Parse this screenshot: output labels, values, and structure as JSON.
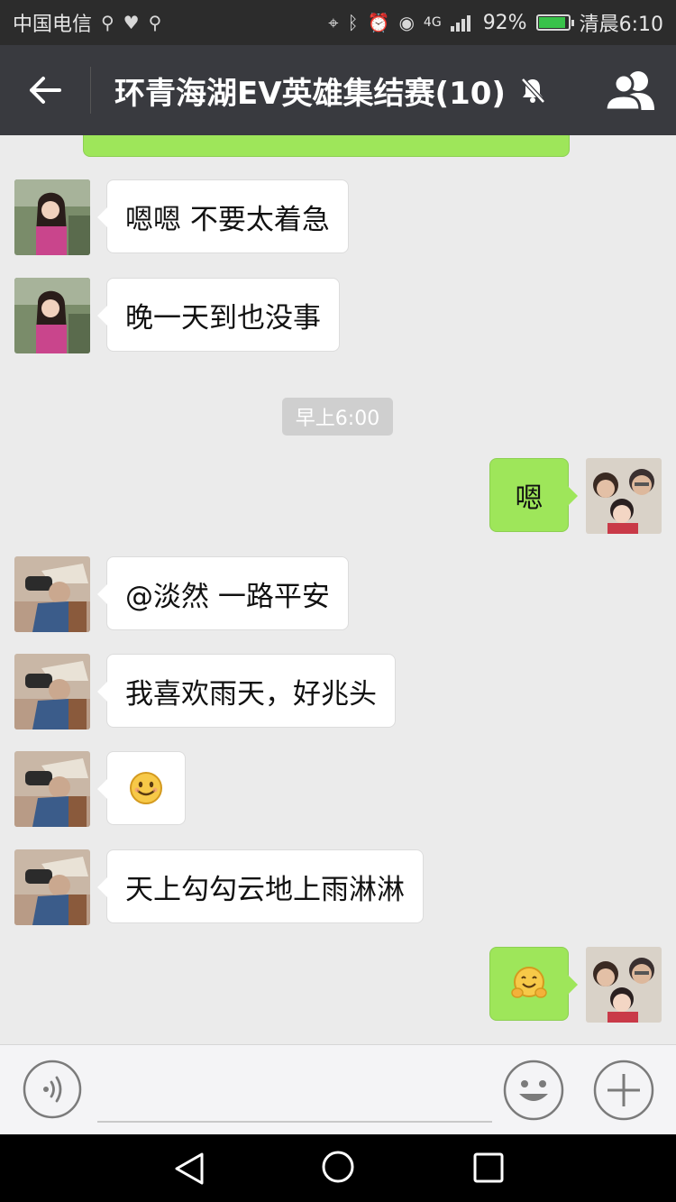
{
  "status_bar": {
    "carrier": "中国电信",
    "network": "4G",
    "battery": "92%",
    "time": "清晨6:10"
  },
  "header": {
    "title": "环青海湖EV英雄集结赛(10)"
  },
  "messages": [
    {
      "side": "in",
      "text": "嗯嗯 不要太着急",
      "avatar": "girl-photo"
    },
    {
      "side": "in",
      "text": "晚一天到也没事",
      "avatar": "girl-photo"
    },
    {
      "side": "out",
      "text": "嗯",
      "avatar": "family-photo"
    },
    {
      "side": "in",
      "text": "@淡然 一路平安",
      "avatar": "binocular-photo"
    },
    {
      "side": "in",
      "text": "我喜欢雨天，好兆头",
      "avatar": "binocular-photo"
    },
    {
      "side": "in",
      "text": "",
      "emoji": "smile-emoji",
      "avatar": "binocular-photo"
    },
    {
      "side": "in",
      "text": "天上勾勾云地上雨淋淋",
      "avatar": "binocular-photo"
    },
    {
      "side": "out",
      "text": "",
      "emoji": "hug-emoji",
      "avatar": "family-photo"
    }
  ],
  "timestamp": "早上6:00",
  "input": {
    "value": "",
    "placeholder": ""
  },
  "colors": {
    "title_bar": "#393a3f",
    "status_bar": "#2c2c2c",
    "chat_bg": "#ebebeb",
    "outgoing_bubble": "#9ee65a",
    "incoming_bubble": "#ffffff"
  }
}
